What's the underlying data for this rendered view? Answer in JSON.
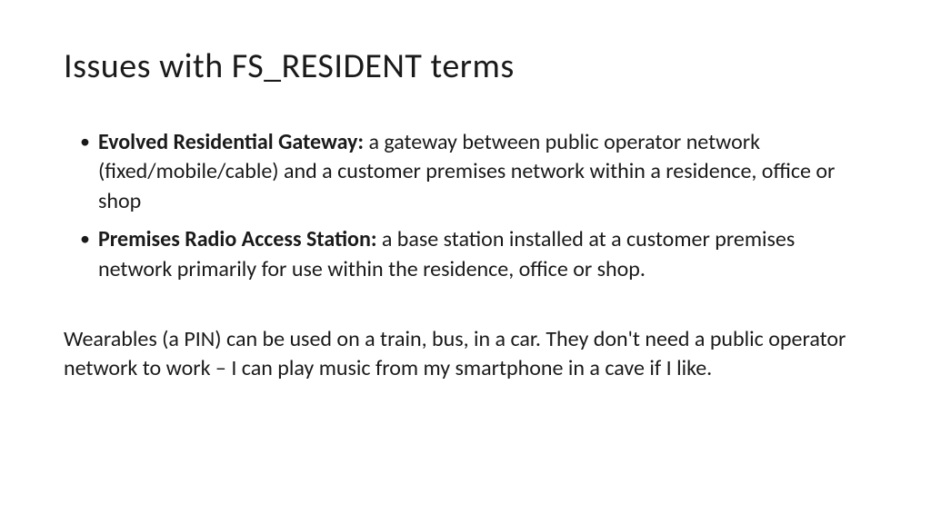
{
  "title": "Issues with FS_RESIDENT terms",
  "bullets": [
    {
      "term": "Evolved Residential Gateway:",
      "definition": " a gateway between public operator network (fixed/mobile/cable) and a customer premises network within a residence, office or shop"
    },
    {
      "term": "Premises Radio Access Station:",
      "definition": " a base station installed at a customer premises network primarily for use within the residence, office or shop."
    }
  ],
  "paragraph": "Wearables (a PIN) can be used on a train, bus, in a car.  They don't need a  public operator network to work – I can play music from my smartphone in a cave if I like."
}
